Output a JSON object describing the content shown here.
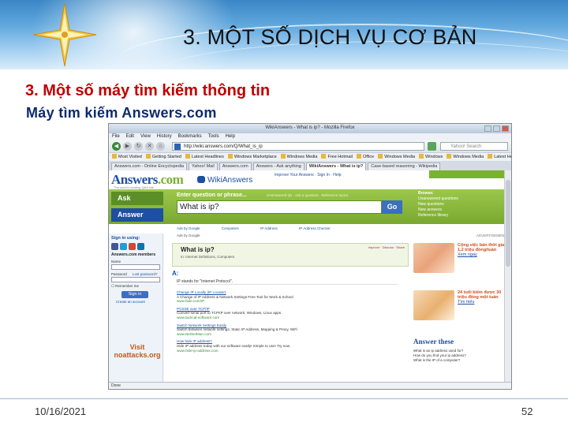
{
  "slide": {
    "title": "3. MỘT SỐ DỊCH VỤ CƠ BẢN",
    "heading": "3. Một số máy tìm kiếm thông tin",
    "subheading": "Máy tìm kiếm Answers.com",
    "date": "10/16/2021",
    "page_number": "52"
  },
  "browser": {
    "window_title": "WikiAnswers - What is ip? - Mozilla Firefox",
    "menu": [
      "File",
      "Edit",
      "View",
      "History",
      "Bookmarks",
      "Tools",
      "Help"
    ],
    "url": "http://wiki.answers.com/Q/What_is_ip",
    "search_placeholder": "Yahoo! Search",
    "bookmarks": [
      "Most Visited",
      "Getting Started",
      "Latest Headlines",
      "Windows Marketplace",
      "Windows Media",
      "Free Hotmail",
      "Office",
      "Windows Media",
      "Windows",
      "Windows Media",
      "Latest Headlines"
    ],
    "tabs": [
      "Answers.com - Online Encyclopedia",
      "Yahoo! Mail",
      "Answers.com",
      "Answers - Ask anything",
      "WikiAnswers - What is ip?",
      "Case-based reasoning - Wikipedia"
    ],
    "status": "Done"
  },
  "site": {
    "logo_main": "Answers",
    "logo_suffix": ".com",
    "tagline": "The world's leading Q&A site",
    "wiki_label": "WikiAnswers",
    "top_links": "Improve Your Answers  ·  Sign In  ·  Help",
    "ask_tab": "Ask",
    "answer_tab": "Answer",
    "enter_label": "Enter question or phrase...",
    "enter_sub": "Unanswered Qs  ·  Ask a question  ·  Reference topics",
    "question_value": "What is ip?",
    "go_button": "Go",
    "browse_title": "Browse:",
    "browse_links": [
      "Unanswered questions",
      "New questions",
      "New answers",
      "Reference library"
    ],
    "sub_links": [
      "Ads by Google",
      "Computers",
      "IP Address",
      "IP Address Checker"
    ],
    "signin_title": "Sign in using:",
    "member_head": "Answers.com members",
    "name_label": "Name",
    "password_label": "Password",
    "forgot_label": "Lost password?",
    "remember_label": "Remember me",
    "signin_button": "Sign in",
    "create_account": "Create an account",
    "visit_ad": "Visit noattacks.org",
    "ads_by": "Ads by Google",
    "question_title": "What is ip?",
    "question_in": "In: Internet Definitions, Computers",
    "question_meta": "Improve  ·  Discuss  ·  Share",
    "answer_letter": "A:",
    "answer_text": "IP stands for \"Internet Protocol\".",
    "results": [
      {
        "title": "Change IP Locally (IP Locator)",
        "desc": "A Change of IP Address & Network Settings Free Tool for Work & School",
        "url": "www.hide.com/IP"
      },
      {
        "title": "PCSSE over TCP/IP",
        "desc": "Convert serial port to TCP/IP over network, Windows, Linux apps",
        "url": "www.tactical-software.com"
      },
      {
        "title": "Switch Network Settings Easily",
        "desc": "Switch between network settings: Static IP Address, Mapping & Proxy, WiFi",
        "url": "www.NetSetMan.com"
      },
      {
        "title": "How hide IP address?",
        "desc": "Hide IP address today with our software easily! Simple to use! Try now",
        "url": "www.hide-ip-address.com"
      }
    ],
    "ad_header": "ADVERTISEMENT",
    "ad1_text": "Cộng việc bán thời gian 1,2 triệu đồng/tuần",
    "ad1_link": "Xem ngay",
    "ad2_text": "24 tuổi kiếm được 30 triệu đồng một tuần",
    "ad2_link": "Tìm hiểu",
    "answer_these": "Answer these",
    "answer_these_lines": [
      "What is an ip address used for?",
      "How do you find your ip address?",
      "What is the IP of a computer?"
    ]
  },
  "colors": {
    "heading_red": "#c00000",
    "subheading_navy": "#0b2a6f",
    "answers_blue": "#1d4fa3",
    "answers_green": "#7ab32e"
  }
}
